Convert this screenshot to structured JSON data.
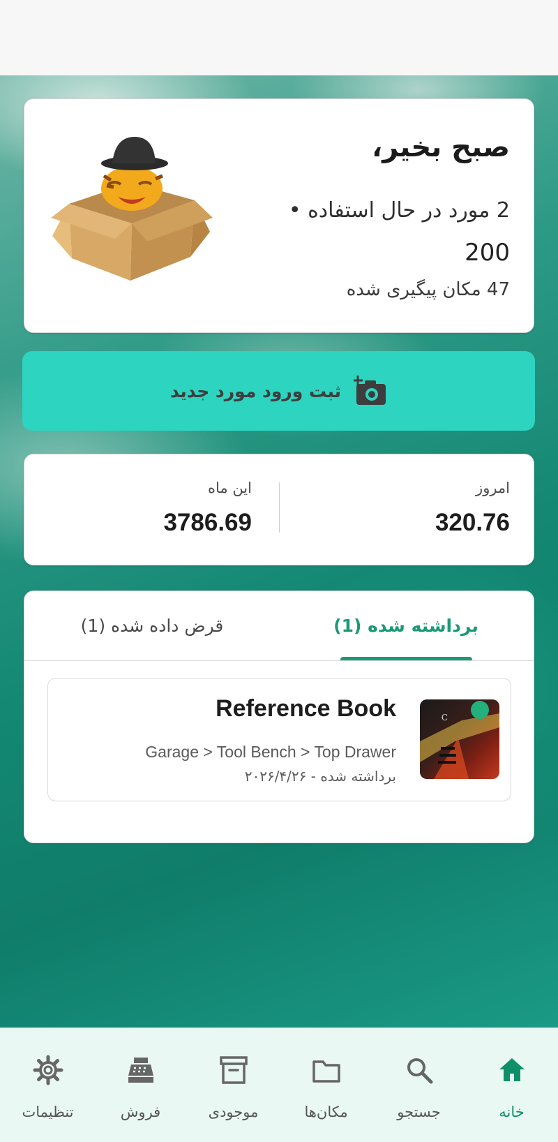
{
  "greeting": {
    "title": "صبح بخیر،",
    "items_in_use": "2 مورد در حال استفاده •",
    "count": "200",
    "locations": "47 مکان پیگیری شده"
  },
  "cta": {
    "label": "ثبت ورود مورد جدید",
    "icon": "add-photo-icon"
  },
  "stats": {
    "today_label": "امروز",
    "today_value": "320.76",
    "month_label": "این ماه",
    "month_value": "3786.69"
  },
  "tabs": [
    {
      "label": "برداشته شده (1)",
      "active": true
    },
    {
      "label": "قرض داده شده (1)",
      "active": false
    }
  ],
  "item": {
    "title": "Reference Book",
    "path": "Garage > Tool Bench > Top Drawer",
    "date": "برداشته شده - ۲۰۲۶/۴/۲۶"
  },
  "nav": [
    {
      "label": "خانه",
      "icon": "home-icon",
      "active": true
    },
    {
      "label": "جستجو",
      "icon": "search-icon",
      "active": false
    },
    {
      "label": "مکان‌ها",
      "icon": "folder-icon",
      "active": false
    },
    {
      "label": "موجودی",
      "icon": "archive-icon",
      "active": false
    },
    {
      "label": "فروش",
      "icon": "cash-register-icon",
      "active": false
    },
    {
      "label": "تنظیمات",
      "icon": "gear-icon",
      "active": false
    }
  ],
  "colors": {
    "accent": "#1a9a76",
    "cta_bg": "#2dd4bf",
    "nav_bg": "#e9f8f2"
  }
}
